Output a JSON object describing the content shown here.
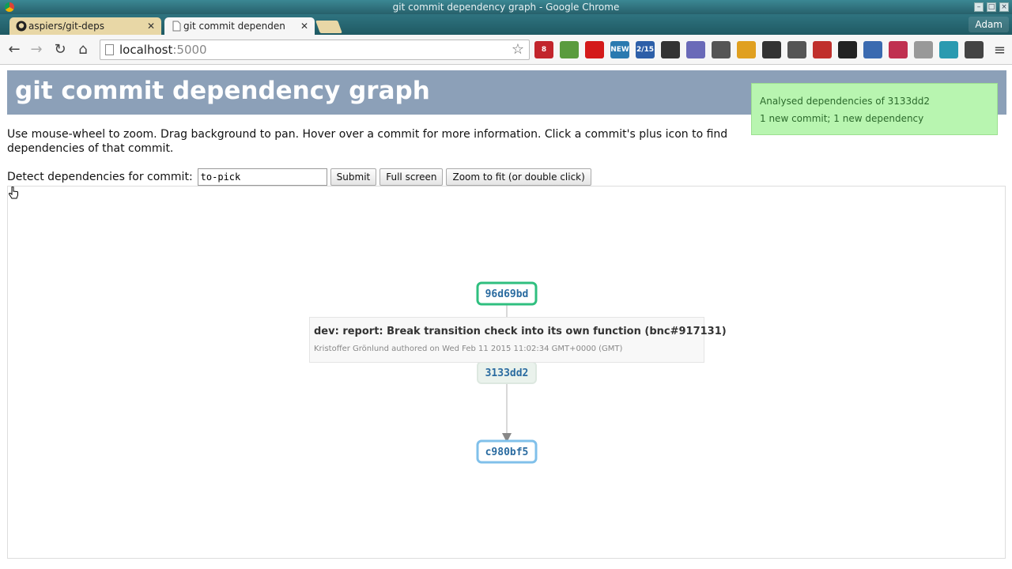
{
  "window": {
    "title": "git commit dependency graph - Google Chrome"
  },
  "tabs": [
    {
      "label": "aspiers/git-deps",
      "icon": "github-icon",
      "color": "#e8d7a6"
    },
    {
      "label": "git commit dependen",
      "icon": "page-icon",
      "active": true
    }
  ],
  "profile": {
    "name": "Adam"
  },
  "toolbar": {
    "url_host": "localhost",
    "url_port": ":5000"
  },
  "extensions": [
    {
      "name": "lastpass-icon",
      "badge": "8",
      "color": "#c2252c"
    },
    {
      "name": "evernote-icon",
      "color": "#5a9b3e"
    },
    {
      "name": "adblock-icon",
      "color": "#d41a1a"
    },
    {
      "name": "new-badge-icon",
      "badge": "NEW",
      "color": "#2a7ab0"
    },
    {
      "name": "calendar-icon",
      "badge": "2/15",
      "color": "#2d5fa8"
    },
    {
      "name": "delicious-icon",
      "color": "#333"
    },
    {
      "name": "globe-icon",
      "color": "#6a6ab8"
    },
    {
      "name": "puzzle-icon",
      "color": "#555"
    },
    {
      "name": "signin-icon",
      "color": "#e0a020"
    },
    {
      "name": "settings-icon",
      "color": "#333"
    },
    {
      "name": "pocket-icon",
      "color": "#555"
    },
    {
      "name": "bookmark-icon",
      "color": "#c0302c"
    },
    {
      "name": "grid-icon",
      "color": "#222"
    },
    {
      "name": "earth-icon",
      "color": "#3a6ab0"
    },
    {
      "name": "plus-cross-icon",
      "color": "#c03050"
    },
    {
      "name": "sphere-icon",
      "color": "#999"
    },
    {
      "name": "m-icon",
      "color": "#2a9ab0"
    },
    {
      "name": "clock-icon",
      "color": "#444"
    }
  ],
  "page": {
    "title": "git commit dependency graph",
    "notice": [
      "Analysed dependencies of 3133dd2",
      "1 new commit; 1 new dependency"
    ],
    "help": "Use mouse-wheel to zoom. Drag background to pan. Hover over a commit for more information. Click a commit's plus icon to find dependencies of that commit.",
    "form": {
      "label": "Detect dependencies for commit:",
      "value": "to-pick",
      "submit": "Submit",
      "fullscreen": "Full screen",
      "zoom": "Zoom to fit (or double click)"
    }
  },
  "graph": {
    "nodes": [
      {
        "id": "96d69bd",
        "color": "#2fbf7f"
      },
      {
        "id": "3133dd2",
        "color": "#dde8e0"
      },
      {
        "id": "c980bf5",
        "color": "#80c0ea"
      }
    ],
    "tooltip": {
      "title": "dev: report: Break transition check into its own function (bnc#917131)",
      "meta": "Kristoffer Grönlund authored on Wed Feb 11 2015 11:02:34 GMT+0000 (GMT)"
    }
  }
}
